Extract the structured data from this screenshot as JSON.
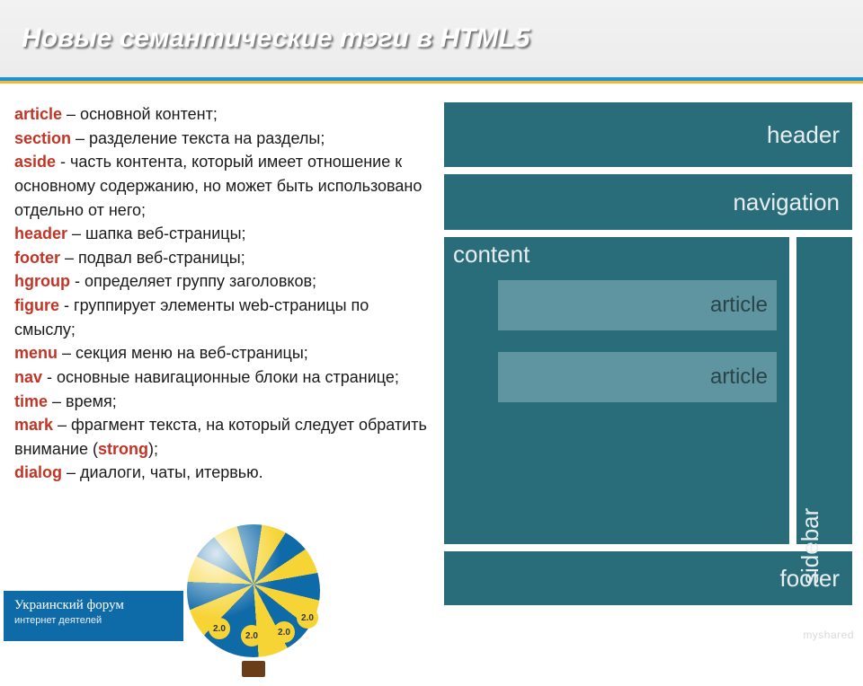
{
  "title": "Новые семантические тэги в HTML5",
  "tags": {
    "article": {
      "name": "article",
      "desc": " – основной контент;"
    },
    "section": {
      "name": "section",
      "desc": " – разделение текста на разделы;"
    },
    "aside": {
      "name": "aside",
      "desc": " - часть контента, который имеет отношение к основному содержанию, но может быть использовано отдельно от него;"
    },
    "header": {
      "name": "header",
      "desc": " – шапка веб-страницы;"
    },
    "footer": {
      "name": "footer",
      "desc": " – подвал веб-страницы;"
    },
    "hgroup": {
      "name": "hgroup",
      "desc": " - определяет группу заголовков;"
    },
    "figure": {
      "name": "figure",
      "desc": " - группирует элементы web-страницы по смыслу;"
    },
    "menu": {
      "name": "menu",
      "desc": " – секция меню на веб-страницы;"
    },
    "nav": {
      "name": "nav",
      "desc": " - основные навигационные блоки на странице;"
    },
    "time": {
      "name": "time",
      "desc": " – время;"
    },
    "mark": {
      "name": "mark",
      "desc_a": " – фрагмент текста, на который следует обратить внимание (",
      "strong": "strong",
      "desc_b": ");"
    },
    "dialog": {
      "name": "dialog",
      "desc": " – диалоги, чаты, итервью."
    }
  },
  "diagram": {
    "header": "header",
    "navigation": "navigation",
    "content": "content",
    "article1": "article",
    "article2": "article",
    "sidebar": "sidebar",
    "footer": "footer"
  },
  "balloon_tags": {
    "t1": "2.0",
    "t2": "2.0",
    "t3": "2.0",
    "t4": "2.0"
  },
  "forum": {
    "line1": "Украинский форум",
    "line2": "интернет деятелей"
  },
  "watermark": "myshared"
}
